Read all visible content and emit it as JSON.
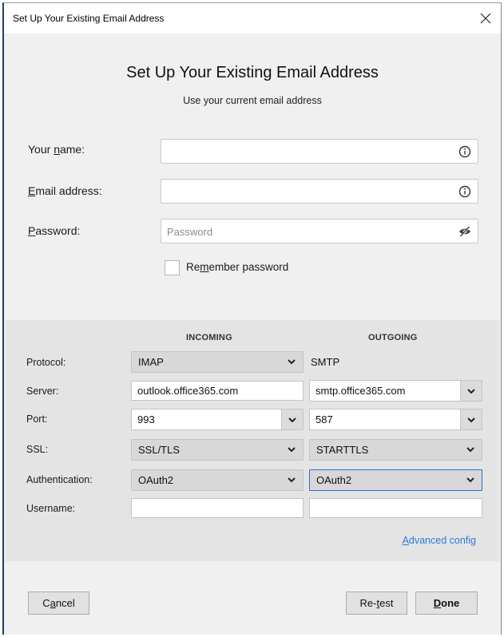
{
  "window": {
    "title": "Set Up Your Existing Email Address",
    "close_icon": "close-x-icon"
  },
  "header": {
    "title": "Set Up Your Existing Email Address",
    "subtitle": "Use your current email address"
  },
  "form": {
    "name": {
      "label_pre": "Your ",
      "label_key": "n",
      "label_post": "ame:",
      "value": "",
      "icon": "info-icon"
    },
    "email": {
      "label_pre": "",
      "label_key": "E",
      "label_post": "mail address:",
      "value": "",
      "icon": "info-icon"
    },
    "password": {
      "label_pre": "",
      "label_key": "P",
      "label_post": "assword:",
      "value": "",
      "placeholder": "Password",
      "icon": "eye-slash-icon"
    },
    "remember": {
      "label_pre": "Re",
      "label_key": "m",
      "label_post": "ember password",
      "checked": false
    }
  },
  "server": {
    "incoming_header": "INCOMING",
    "outgoing_header": "OUTGOING",
    "rows": {
      "protocol": {
        "label": "Protocol:",
        "incoming": "IMAP",
        "outgoing": "SMTP"
      },
      "server": {
        "label": "Server:",
        "incoming": "outlook.office365.com",
        "outgoing": "smtp.office365.com"
      },
      "port": {
        "label": "Port:",
        "incoming": "993",
        "outgoing": "587"
      },
      "ssl": {
        "label": "SSL:",
        "incoming": "SSL/TLS",
        "outgoing": "STARTTLS"
      },
      "auth": {
        "label": "Authentication:",
        "incoming": "OAuth2",
        "outgoing": "OAuth2"
      },
      "username": {
        "label": "Username:",
        "incoming": "",
        "outgoing": ""
      }
    },
    "advanced": {
      "key": "A",
      "rest": "dvanced config"
    }
  },
  "buttons": {
    "cancel": {
      "pre": "C",
      "key": "a",
      "post": "ncel"
    },
    "retest": {
      "pre": "Re-",
      "key": "t",
      "post": "est"
    },
    "done": {
      "pre": "",
      "key": "D",
      "post": "one"
    }
  },
  "colors": {
    "link": "#2a7bd8",
    "focus_border": "#2b6fcf",
    "section_bg": "#e4e4e4",
    "dialog_bg": "#f0f0f0"
  }
}
